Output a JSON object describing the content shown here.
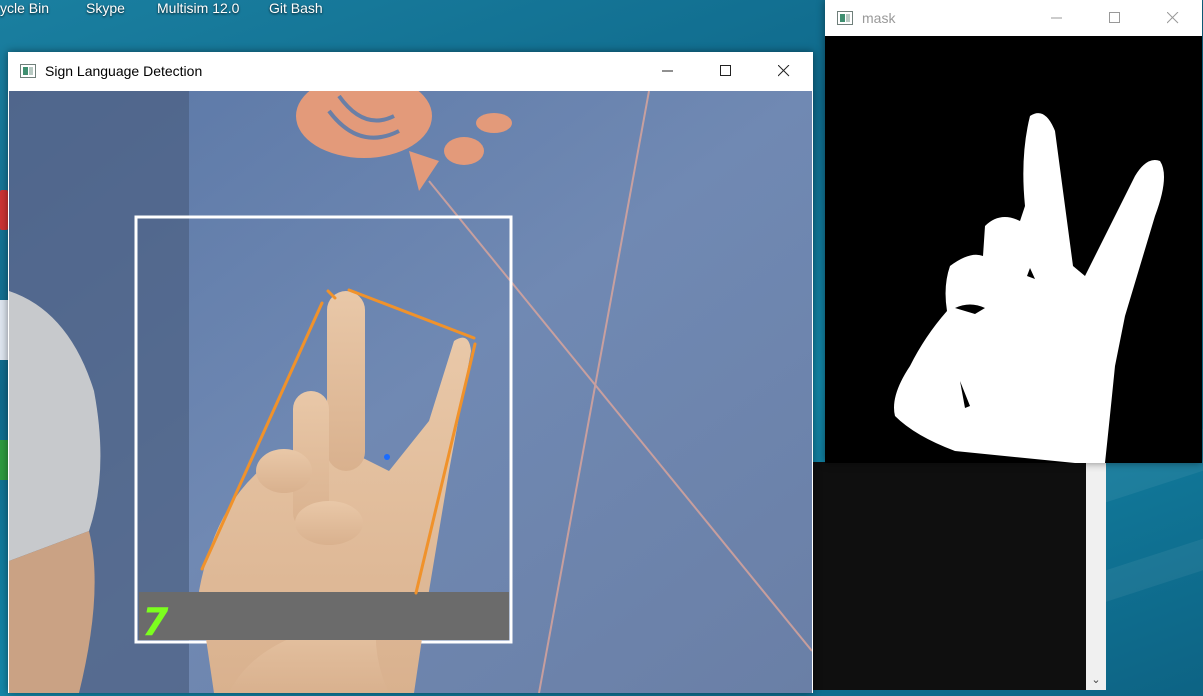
{
  "desktop": {
    "icons": [
      {
        "label": "ycle Bin"
      },
      {
        "label": "Skype"
      },
      {
        "label": "Multisim 12.0"
      },
      {
        "label": "Git Bash"
      }
    ]
  },
  "main_window": {
    "title": "Sign Language Detection",
    "minimize_glyph": "—",
    "prediction": "7",
    "colors": {
      "roi_box": "#ffffff",
      "hull_line": "#f0922b",
      "defect_point": "#1a6cff",
      "prediction_text": "#7cff1e",
      "label_bar": "#6b6b6b"
    }
  },
  "mask_window": {
    "title": "mask",
    "minimize_glyph": "—"
  }
}
